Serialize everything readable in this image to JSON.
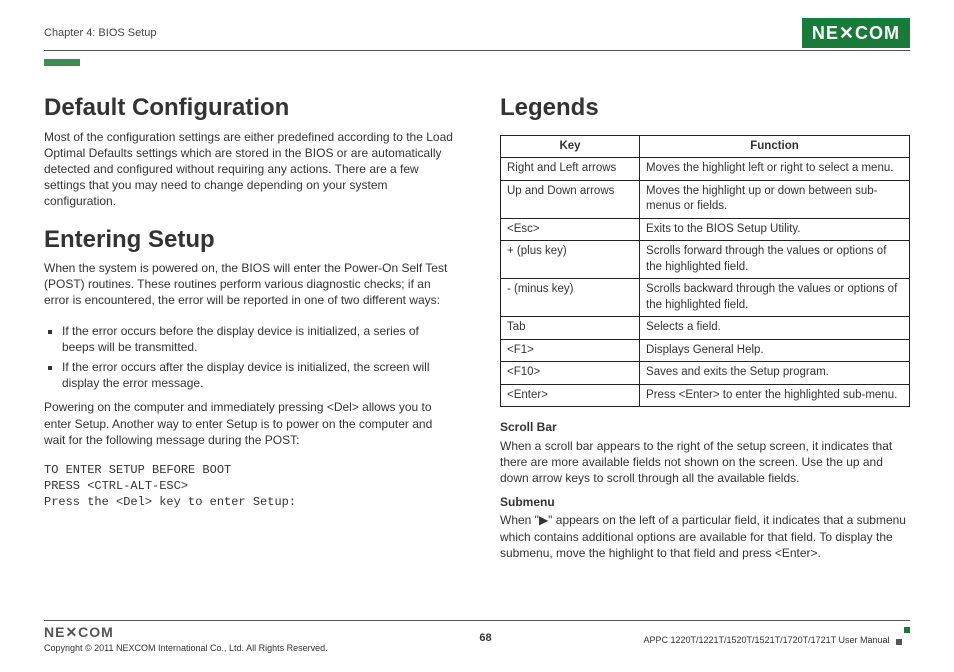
{
  "header": {
    "chapter": "Chapter 4: BIOS Setup",
    "logo_text": "NE✕COM"
  },
  "left": {
    "h_default": "Default Configuration",
    "p_default": "Most of the configuration settings are either predefined according to the Load Optimal Defaults settings which are stored in the BIOS or are automatically detected and configured without requiring any actions. There are a few settings that you may need to change depending on your system configuration.",
    "h_entering": "Entering Setup",
    "p_entering": "When the system is powered on, the BIOS will enter the Power-On Self Test (POST) routines. These routines perform various diagnostic checks; if an error is encountered, the error will be reported in one of two different ways:",
    "bullet1": "If the error occurs before the display device is initialized, a series of beeps will be transmitted.",
    "bullet2": "If the error occurs after the display device is initialized, the screen will display the error message.",
    "p_power": "Powering on the computer and immediately pressing <Del> allows you to enter Setup. Another way to enter Setup is to power on the computer and wait for the following message during the POST:",
    "code": "TO ENTER SETUP BEFORE BOOT\nPRESS <CTRL-ALT-ESC>\nPress the <Del> key to enter Setup:"
  },
  "right": {
    "h_legends": "Legends",
    "th_key": "Key",
    "th_func": "Function",
    "rows": [
      {
        "k": "Right and Left arrows",
        "f": "Moves the highlight left or right to select a menu."
      },
      {
        "k": "Up and Down arrows",
        "f": "Moves the highlight up or down between sub-menus or fields."
      },
      {
        "k": "<Esc>",
        "f": "Exits to the BIOS Setup Utility."
      },
      {
        "k": "+ (plus key)",
        "f": "Scrolls forward through the values or options of the highlighted field."
      },
      {
        "k": "- (minus key)",
        "f": "Scrolls backward through the values or options of the highlighted field."
      },
      {
        "k": "Tab",
        "f": "Selects a field."
      },
      {
        "k": "<F1>",
        "f": "Displays General Help."
      },
      {
        "k": "<F10>",
        "f": "Saves and exits the Setup program."
      },
      {
        "k": "<Enter>",
        "f": "Press <Enter> to enter the highlighted sub-menu."
      }
    ],
    "sub_scroll_h": "Scroll Bar",
    "sub_scroll_p": "When a scroll bar appears to the right of the setup screen, it indicates that there are more available fields not shown on the screen. Use the up and down arrow keys to scroll through all the available fields.",
    "sub_menu_h": "Submenu",
    "sub_menu_p": "When \"▶\" appears on the left of a particular field, it indicates that a submenu which contains additional options are available for that field. To display the submenu, move the highlight to that field and press <Enter>."
  },
  "footer": {
    "logo": "NE✕COM",
    "copyright": "Copyright © 2011 NEXCOM International Co., Ltd. All Rights Reserved.",
    "page": "68",
    "manual": "APPC 1220T/1221T/1520T/1521T/1720T/1721T User Manual"
  }
}
